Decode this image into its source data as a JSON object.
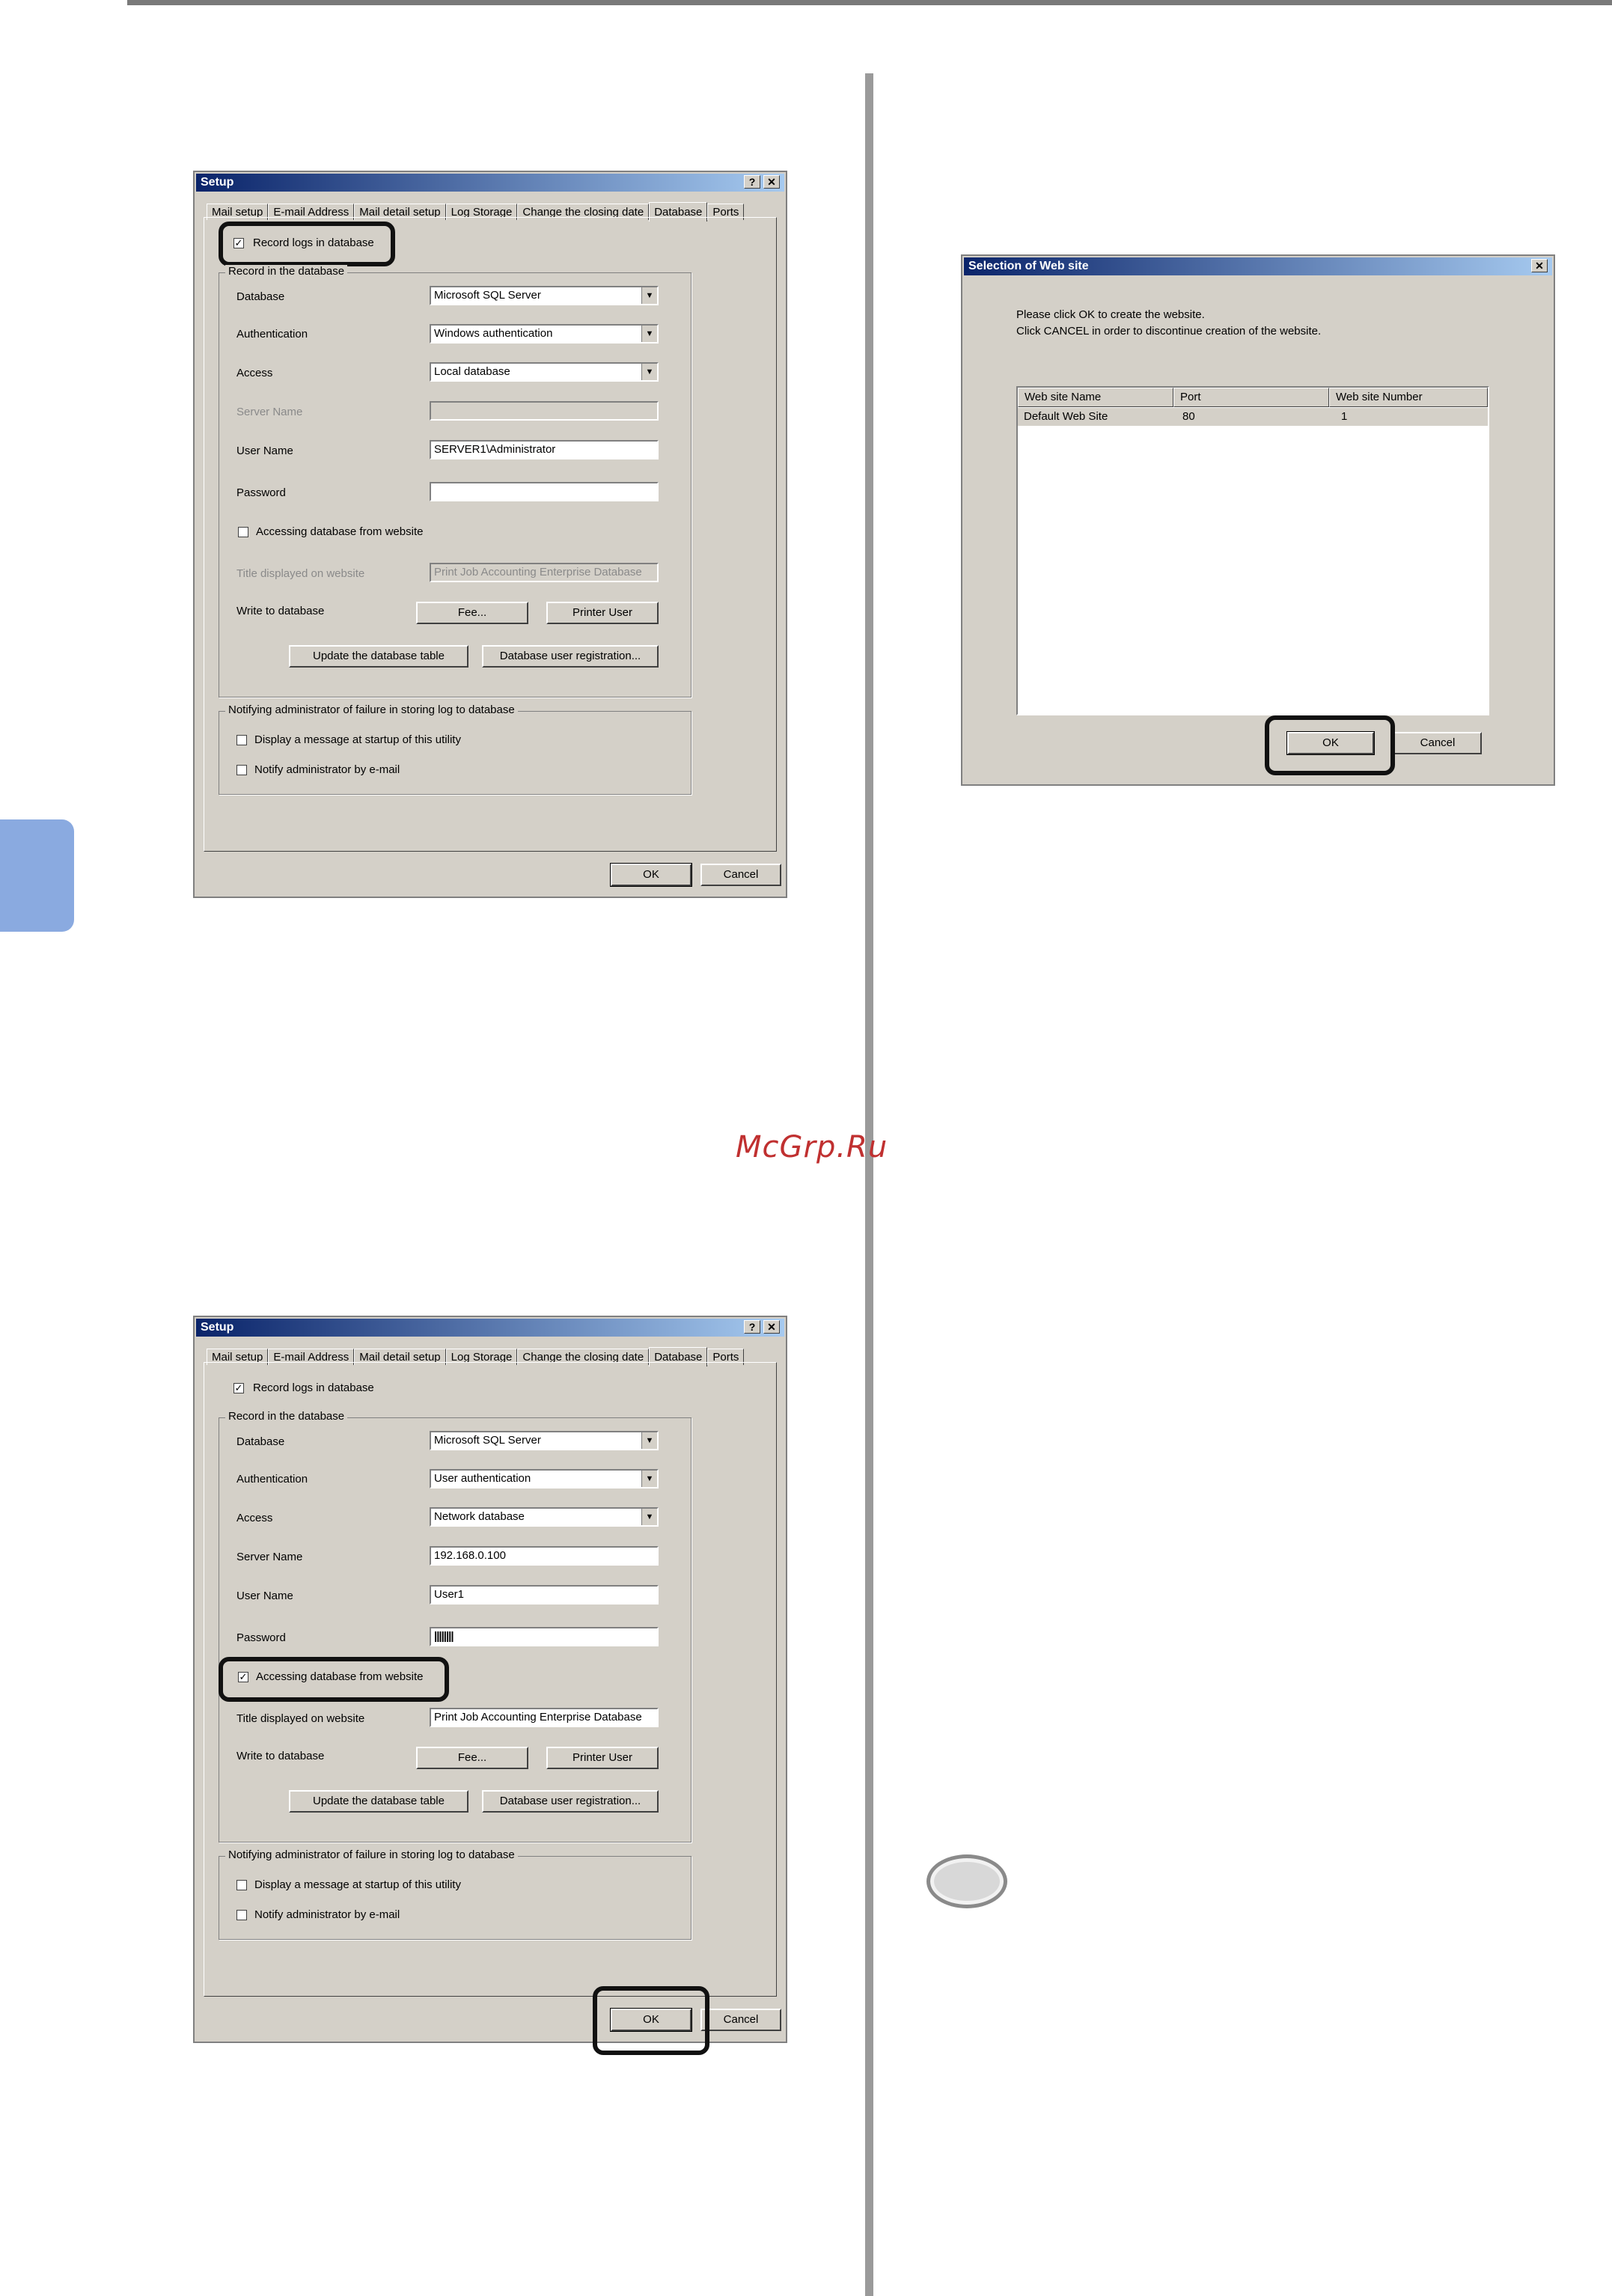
{
  "watermark": "McGrp.Ru",
  "setup": {
    "title": "Setup",
    "help_btn": "?",
    "close_btn": "✕",
    "tabs": [
      "Mail setup",
      "E-mail Address",
      "Mail detail setup",
      "Log Storage",
      "Change the closing date",
      "Database",
      "Ports"
    ],
    "record_logs": "Record logs in database",
    "group_record": "Record in the database",
    "database_label": "Database",
    "authentication_label": "Authentication",
    "access_label": "Access",
    "server_name_label": "Server Name",
    "user_name_label": "User Name",
    "password_label": "Password",
    "accessing_web": "Accessing database from website",
    "title_web_label": "Title displayed on website",
    "write_db_label": "Write to database",
    "fee_btn": "Fee...",
    "printer_user_btn": "Printer User",
    "update_btn": "Update the database table",
    "db_user_reg_btn": "Database user registration...",
    "group_notify": "Notifying administrator of failure in storing log to database",
    "display_msg": "Display a message at startup of this utility",
    "notify_email": "Notify administrator by e-mail",
    "ok_btn": "OK",
    "cancel_btn": "Cancel",
    "checkmark": "✓"
  },
  "dialog1": {
    "database": "Microsoft SQL Server",
    "authentication": "Windows authentication",
    "access": "Local database",
    "server_name": "",
    "user_name": "SERVER1\\Administrator",
    "password": "",
    "title_web": "Print Job Accounting Enterprise Database"
  },
  "dialog2": {
    "database": "Microsoft SQL Server",
    "authentication": "User authentication",
    "access": "Network database",
    "server_name": "192.168.0.100",
    "user_name": "User1",
    "password": "||||||||",
    "title_web": "Print Job Accounting Enterprise Database"
  },
  "website_dialog": {
    "title": "Selection of Web site",
    "close_btn": "✕",
    "msg1": "Please click OK to create the website.",
    "msg2": "Click CANCEL in order to discontinue creation of the website.",
    "columns": [
      "Web site Name",
      "Port",
      "Web site Number"
    ],
    "row": [
      "Default Web Site",
      "80",
      "1"
    ],
    "ok_btn": "OK",
    "cancel_btn": "Cancel"
  }
}
